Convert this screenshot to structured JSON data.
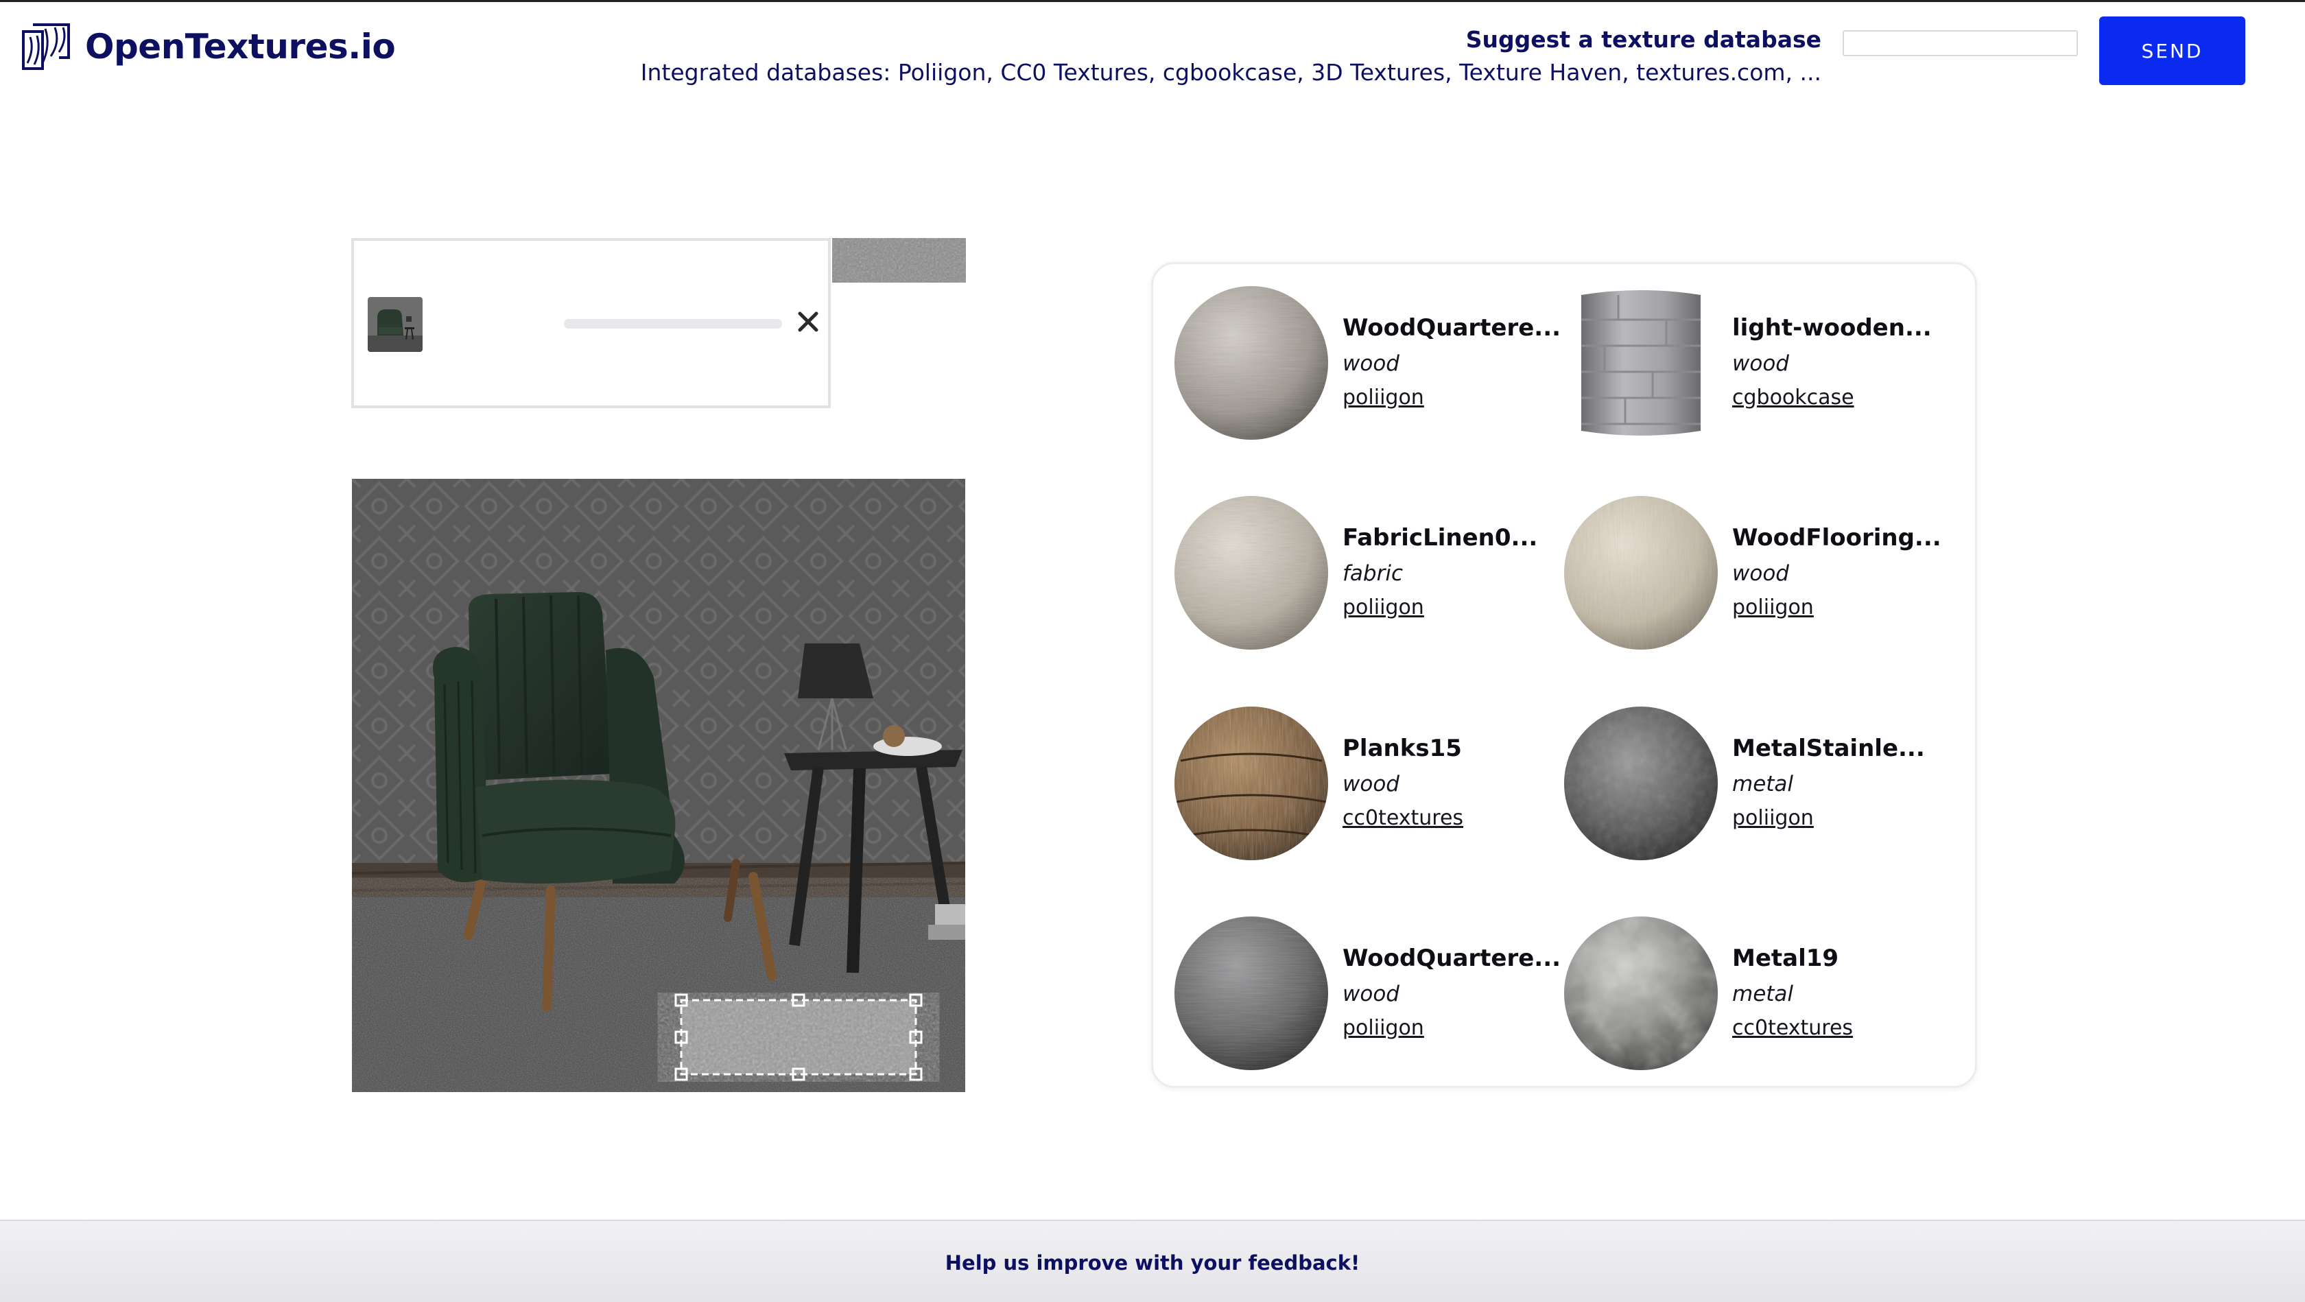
{
  "header": {
    "logo_text": "OpenTextures.io",
    "suggest_title": "Suggest a texture database",
    "integrated_databases": "Integrated databases: Poliigon, CC0 Textures, cgbookcase, 3D Textures, Texture Haven, textures.com, ...",
    "suggest_input_value": "",
    "suggest_input_placeholder": "",
    "send_label": "SEND"
  },
  "upload": {
    "progress_fraction": 0,
    "close_icon": "close-icon"
  },
  "results": [
    {
      "name": "WoodQuartere...",
      "category": "wood",
      "source": "poliigon",
      "swatch": "light-wood-sphere"
    },
    {
      "name": "light-wooden...",
      "category": "wood",
      "source": "cgbookcase",
      "swatch": "wood-cylinder"
    },
    {
      "name": "FabricLinen0...",
      "category": "fabric",
      "source": "poliigon",
      "swatch": "linen-sphere"
    },
    {
      "name": "WoodFlooring...",
      "category": "wood",
      "source": "poliigon",
      "swatch": "beige-wood-sphere"
    },
    {
      "name": "Planks15",
      "category": "wood",
      "source": "cc0textures",
      "swatch": "brown-planks-sphere"
    },
    {
      "name": "MetalStainle...",
      "category": "metal",
      "source": "poliigon",
      "swatch": "dark-metal-sphere"
    },
    {
      "name": "WoodQuartere...",
      "category": "wood",
      "source": "poliigon",
      "swatch": "grey-wood-sphere"
    },
    {
      "name": "Metal19",
      "category": "metal",
      "source": "cc0textures",
      "swatch": "mottled-metal-sphere"
    }
  ],
  "footer": {
    "feedback_label": "Help us improve with your feedback!"
  },
  "colors": {
    "brand_navy": "#0d1060",
    "send_blue": "#0a2af0"
  }
}
